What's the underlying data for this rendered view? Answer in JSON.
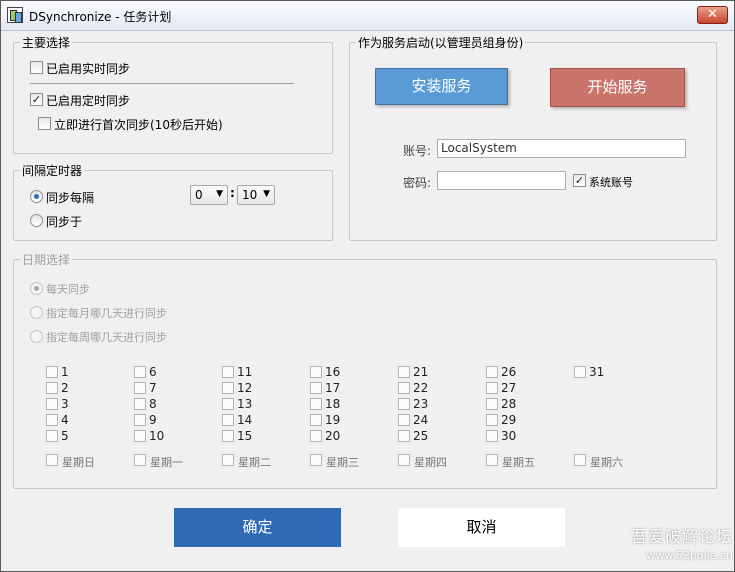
{
  "window": {
    "title": "DSynchronize - 任务计划",
    "close_glyph": "✕"
  },
  "main_select": {
    "legend": "主要选择",
    "realtime_sync": {
      "label": "已启用实时同步",
      "checked": false
    },
    "scheduled_sync": {
      "label": "已启用定时同步",
      "checked": true
    },
    "immediate_first": {
      "label": "立即进行首次同步(10秒后开始)",
      "checked": false
    }
  },
  "interval_timer": {
    "legend": "间隔定时器",
    "every": {
      "label": "同步每隔",
      "selected": true
    },
    "at": {
      "label": "同步于",
      "selected": false
    },
    "hours_value": "0",
    "minutes_value": "10",
    "separator": ":"
  },
  "service": {
    "legend": "作为服务启动(以管理员组身份)",
    "install_label": "安装服务",
    "start_label": "开始服务",
    "account_label": "账号:",
    "account_value": "LocalSystem",
    "password_label": "密码:",
    "password_value": "",
    "system_account_label": "系统账号",
    "system_account_checked": true
  },
  "date_select": {
    "legend": "日期选择",
    "daily": "每天同步",
    "monthly_days": "指定每月哪几天进行同步",
    "weekly_days": "指定每周哪几天进行同步",
    "days": [
      "1",
      "2",
      "3",
      "4",
      "5",
      "6",
      "7",
      "8",
      "9",
      "10",
      "11",
      "12",
      "13",
      "14",
      "15",
      "16",
      "17",
      "18",
      "19",
      "20",
      "21",
      "22",
      "23",
      "24",
      "25",
      "26",
      "27",
      "28",
      "29",
      "30",
      "31"
    ],
    "weekdays": [
      "星期日",
      "星期一",
      "星期二",
      "星期三",
      "星期四",
      "星期五",
      "星期六"
    ]
  },
  "footer": {
    "ok_label": "确定",
    "cancel_label": "取消"
  },
  "watermark": {
    "line1": "吾爱破解论坛",
    "line2": "www.52pojie.cn"
  },
  "colors": {
    "install_button": "#5b9bd5",
    "start_button": "#c9756c",
    "ok_button": "#2e6bb4"
  }
}
